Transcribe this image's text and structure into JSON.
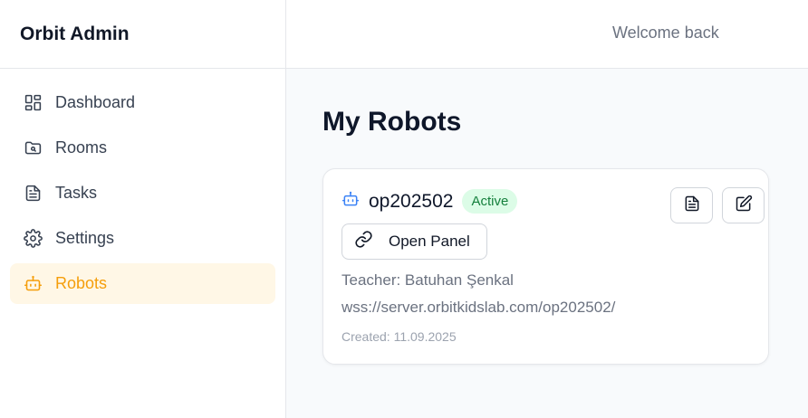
{
  "app": {
    "title": "Orbit Admin"
  },
  "header": {
    "welcome": "Welcome back"
  },
  "sidebar": {
    "items": [
      {
        "label": "Dashboard",
        "icon": "dashboard-icon",
        "active": false
      },
      {
        "label": "Rooms",
        "icon": "folder-icon",
        "active": false
      },
      {
        "label": "Tasks",
        "icon": "document-icon",
        "active": false
      },
      {
        "label": "Settings",
        "icon": "gear-icon",
        "active": false
      },
      {
        "label": "Robots",
        "icon": "robot-icon",
        "active": true
      }
    ]
  },
  "main": {
    "title": "My Robots",
    "robots": [
      {
        "name": "op202502",
        "status": "Active",
        "open_panel_label": "Open Panel",
        "teacher": "Teacher: Batuhan Şenkal",
        "url": "wss://server.orbitkidslab.com/op202502/",
        "created": "Created: 11.09.2025"
      }
    ]
  },
  "colors": {
    "accent": "#f59e0b",
    "active_bg": "#fff7e6",
    "robot_icon": "#3b82f6",
    "badge_bg": "#dcfce7",
    "badge_text": "#15803d"
  }
}
